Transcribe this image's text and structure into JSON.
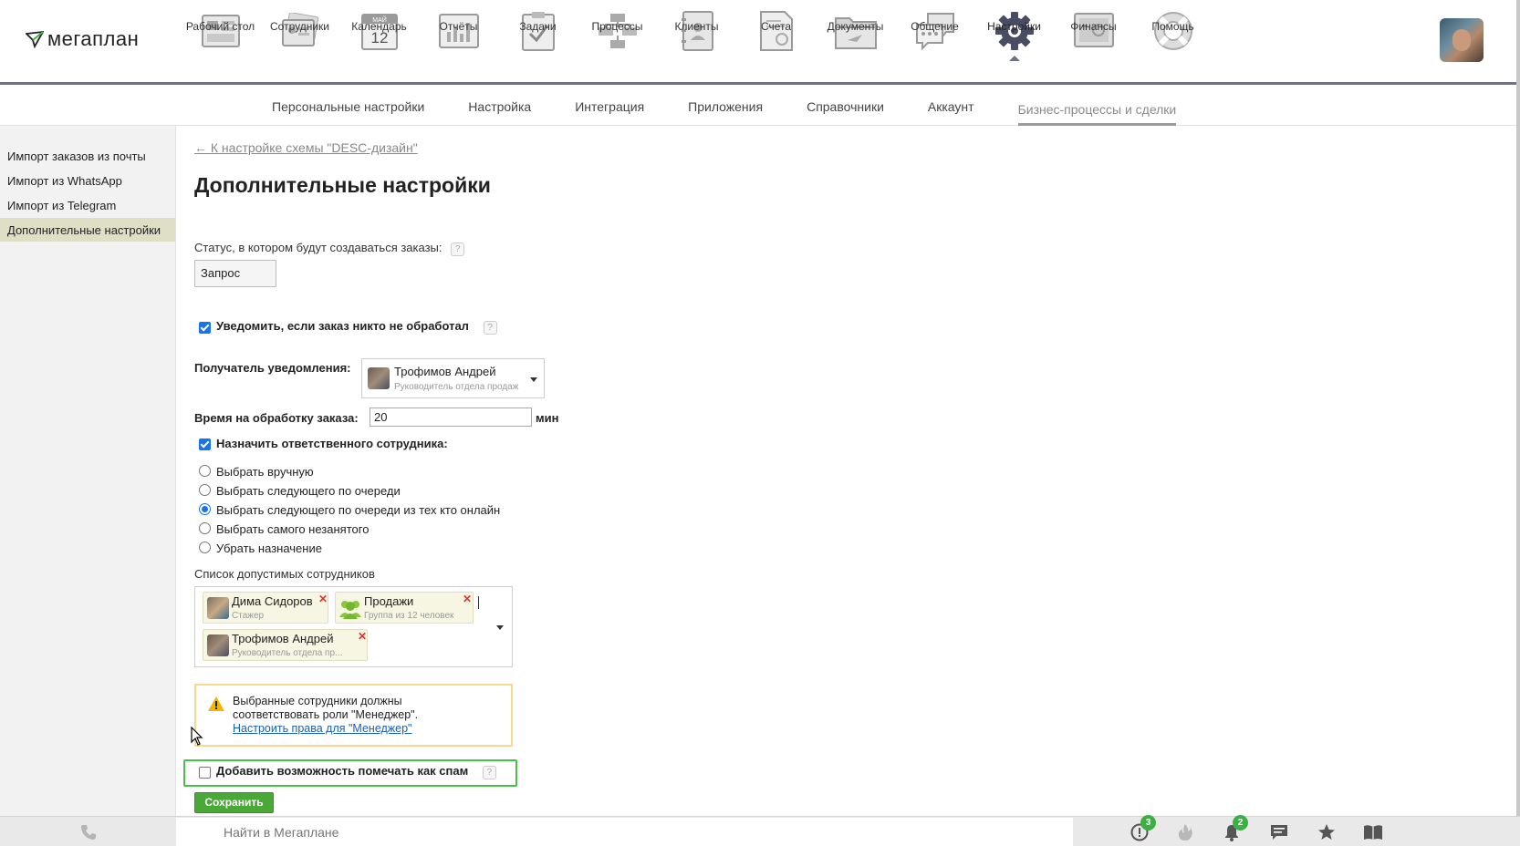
{
  "brand": {
    "name": "мегаплан"
  },
  "nav": {
    "items": [
      {
        "label": "Рабочий стол",
        "icon": "desktop-icon"
      },
      {
        "label": "Сотрудники",
        "icon": "employees-icon"
      },
      {
        "label": "Календарь",
        "icon": "calendar-icon",
        "month": "МАЙ",
        "day": "12"
      },
      {
        "label": "Отчёты",
        "icon": "reports-icon"
      },
      {
        "label": "Задачи",
        "icon": "tasks-icon"
      },
      {
        "label": "Процессы",
        "icon": "processes-icon"
      },
      {
        "label": "Клиенты",
        "icon": "clients-icon"
      },
      {
        "label": "Счета",
        "icon": "invoices-icon"
      },
      {
        "label": "Документы",
        "icon": "documents-icon"
      },
      {
        "label": "Общение",
        "icon": "chat-icon"
      },
      {
        "label": "Настройки",
        "icon": "settings-gear-icon",
        "active": true
      },
      {
        "label": "Финансы",
        "icon": "finance-safe-icon"
      },
      {
        "label": "Помощь",
        "icon": "help-lifebuoy-icon"
      }
    ]
  },
  "subnav": {
    "items": [
      {
        "label": "Персональные настройки"
      },
      {
        "label": "Настройка"
      },
      {
        "label": "Интеграция"
      },
      {
        "label": "Приложения"
      },
      {
        "label": "Справочники"
      },
      {
        "label": "Аккаунт"
      },
      {
        "label": "Бизнес-процессы и сделки",
        "active": true
      }
    ]
  },
  "sidebar": {
    "items": [
      {
        "label": "Импорт заказов из почты"
      },
      {
        "label": "Импорт из WhatsApp"
      },
      {
        "label": "Импорт из Telegram"
      },
      {
        "label": "Дополнительные настройки",
        "active": true
      }
    ]
  },
  "main": {
    "back_link": "← К настройке схемы \"DESC-дизайн\"",
    "title": "Дополнительные настройки",
    "status_label": "Статус, в котором будут создаваться заказы:",
    "status_value": "Запрос",
    "help_mark": "?",
    "notify_label": "Уведомить, если заказ никто не обработал",
    "notify_checked": true,
    "recipient_label": "Получатель уведомления:",
    "recipient": {
      "name": "Трофимов Андрей",
      "role": "Руководитель отдела продаж"
    },
    "time_label": "Время на обработку заказа:",
    "time_value": "20",
    "time_unit": "мин",
    "assign_label": "Назначить ответственного сотрудника:",
    "assign_checked": true,
    "assign_options": [
      {
        "label": "Выбрать вручную",
        "selected": false
      },
      {
        "label": "Выбрать следующего по очереди",
        "selected": false
      },
      {
        "label": "Выбрать следующего по очереди из тех кто онлайн",
        "selected": true
      },
      {
        "label": "Выбрать самого незанятого",
        "selected": false
      },
      {
        "label": "Убрать назначение",
        "selected": false
      }
    ],
    "employees_label": "Список допустимых сотрудников",
    "employees": [
      {
        "name": "Дима Сидоров",
        "sub": "Стажер"
      },
      {
        "name": "Продажи",
        "sub": "Группа из 12 человек"
      },
      {
        "name": "Трофимов Андрей",
        "sub": "Руководитель отдела пр..."
      }
    ],
    "remove_mark": "✕",
    "warning": {
      "line1": "Выбранные сотрудники должны",
      "line2": "соответствовать роли \"Менеджер\".",
      "link": "Настроить права для \"Менеджер\""
    },
    "spam_label": "Добавить возможность помечать как спам",
    "spam_checked": false,
    "save_label": "Сохранить"
  },
  "bottombar": {
    "search_placeholder": "Найти в Мегаплане",
    "alerts_count": "3",
    "notifications_count": "2"
  },
  "colors": {
    "accent_blue": "#1a73e8",
    "save_green": "#4aa837",
    "highlight_green": "#46c24a",
    "sidebar_active": "#dfdfc6",
    "nav_border": "#6f7280"
  }
}
